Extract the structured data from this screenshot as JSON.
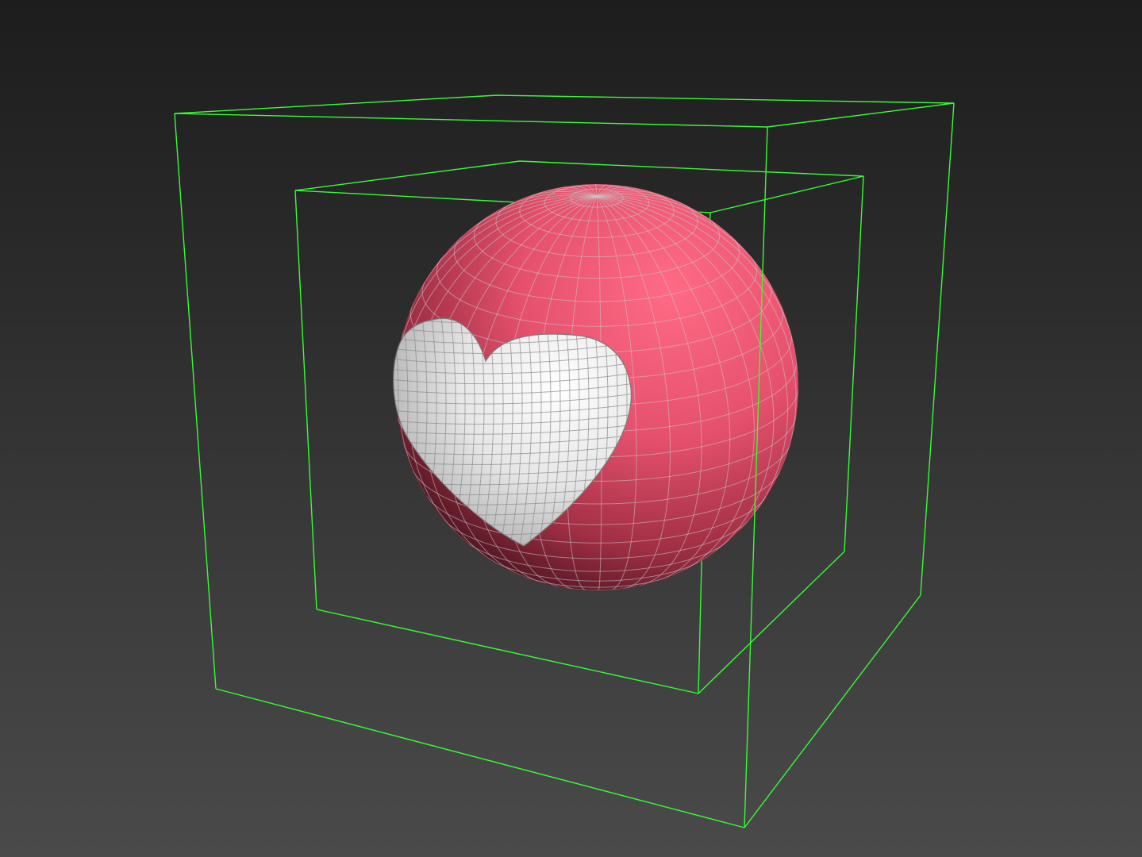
{
  "viewport": {
    "background_top": "#1d1d1d",
    "background_bottom": "#4a4a4a"
  },
  "selection_box_color": "#33ff33",
  "wire_color": "#9a9a9a",
  "objects": [
    {
      "name": "outer-bounding-box",
      "type": "wireframe-box",
      "selected": true
    },
    {
      "name": "inner-bounding-box",
      "type": "wireframe-box",
      "selected": true
    },
    {
      "name": "sphere",
      "type": "mesh",
      "color": "#ee5470",
      "shading": "smooth-with-edged-faces"
    },
    {
      "name": "heart",
      "type": "mesh",
      "color": "#e4e4e4",
      "shading": "smooth-with-edged-faces"
    }
  ]
}
